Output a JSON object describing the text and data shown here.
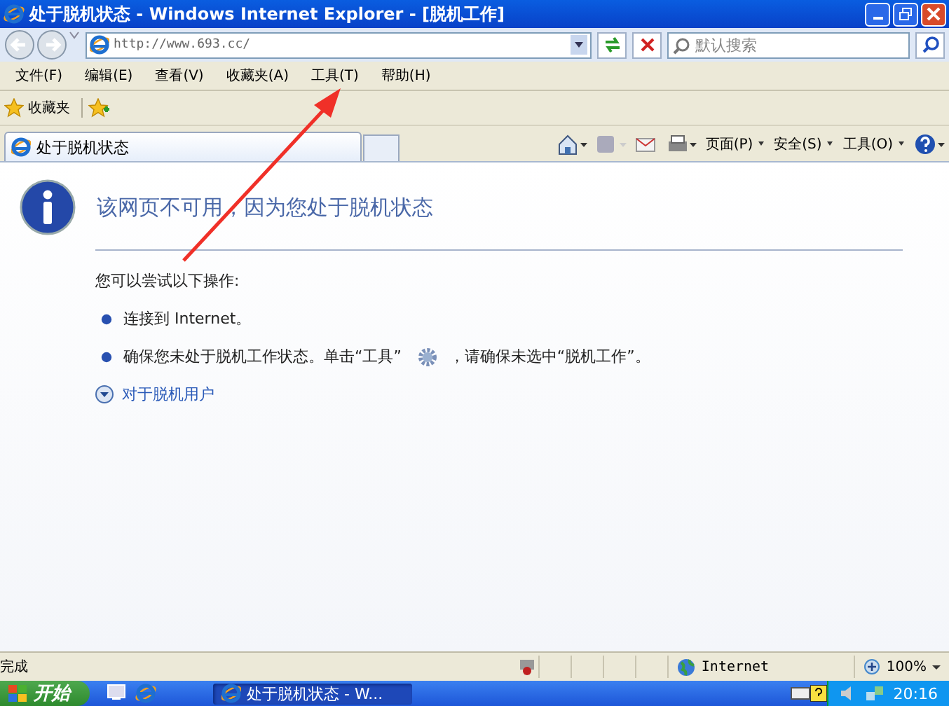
{
  "window": {
    "title": "处于脱机状态 - Windows Internet Explorer - [脱机工作]"
  },
  "address_bar": {
    "url": "http://www.693.cc/"
  },
  "search": {
    "placeholder": "默认搜索"
  },
  "menu": [
    "文件(F)",
    "编辑(E)",
    "查看(V)",
    "收藏夹(A)",
    "工具(T)",
    "帮助(H)"
  ],
  "favorites_bar": {
    "label": "收藏夹"
  },
  "tabs": [
    {
      "label": "处于脱机状态",
      "selected": true
    }
  ],
  "command_bar": [
    "页面(P)",
    "安全(S)",
    "工具(O)"
  ],
  "page": {
    "heading": "该网页不可用，因为您处于脱机状态",
    "intro": "您可以尝试以下操作:",
    "bullets": [
      {
        "text": "连接到 Internet。"
      },
      {
        "text": "确保您未处于脱机工作状态。单击“工具”",
        "after_icon": "，请确保未选中“脱机工作”。"
      }
    ],
    "more_link": "对于脱机用户"
  },
  "status_bar": {
    "text": "完成",
    "zone": "Internet",
    "zoom": "100%"
  },
  "taskbar": {
    "start": "开始",
    "tasks": [
      {
        "label": "处于脱机状态 - W...",
        "selected": true
      }
    ],
    "clock": "20:16"
  }
}
